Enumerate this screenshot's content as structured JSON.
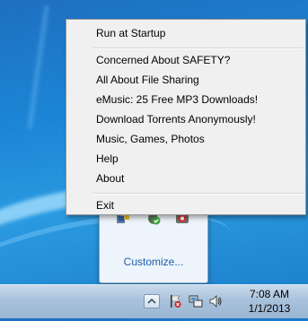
{
  "context_menu": {
    "items": [
      {
        "label": "Run at Startup"
      },
      {
        "label": "Concerned About SAFETY?"
      },
      {
        "label": "All About File Sharing"
      },
      {
        "label": "eMusic: 25 Free MP3 Downloads!"
      },
      {
        "label": "Download Torrents Anonymously!"
      },
      {
        "label": "Music, Games, Photos"
      },
      {
        "label": "Help"
      },
      {
        "label": "About"
      },
      {
        "label": "Exit"
      }
    ]
  },
  "tray_flyout": {
    "icons": [
      "app-tray-icon",
      "shield-check-icon",
      "red-tray-icon"
    ],
    "customize_label": "Customize..."
  },
  "taskbar": {
    "tray_icons": [
      "chevron-up-icon",
      "action-center-flag-icon",
      "network-icon",
      "volume-icon"
    ],
    "time": "7:08 AM",
    "date": "1/1/2013"
  }
}
